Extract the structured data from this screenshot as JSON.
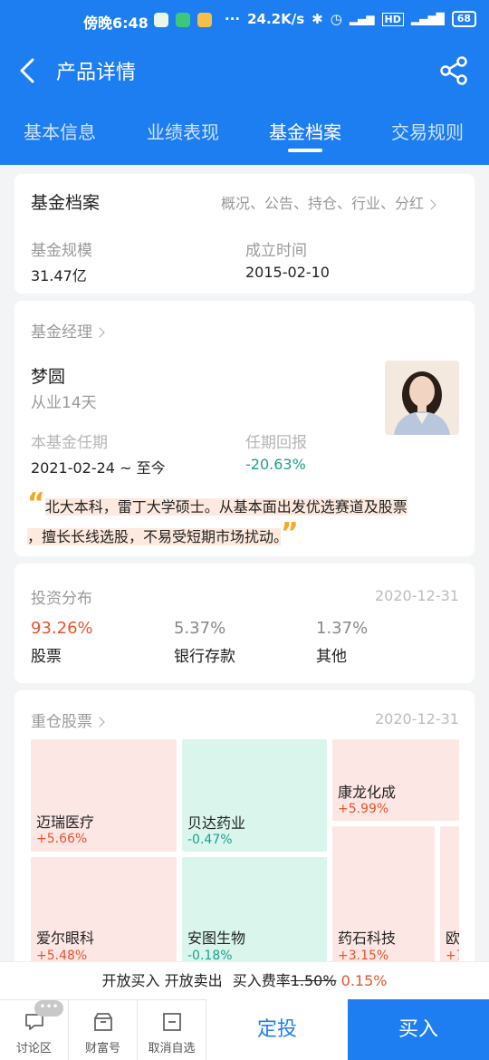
{
  "status_bar": {
    "time": "傍晚6:48",
    "network_speed": "24.2K/s",
    "battery": "68",
    "icons": [
      "wechat-icon",
      "shield-icon",
      "message-icon",
      "more-dots-icon",
      "bluetooth-icon",
      "alarm-icon",
      "signal-3g-icon",
      "hd-icon",
      "signal-4g-icon",
      "battery-icon"
    ]
  },
  "header": {
    "title": "产品详情"
  },
  "tabs": [
    {
      "label": "基本信息",
      "active": false
    },
    {
      "label": "业绩表现",
      "active": false
    },
    {
      "label": "基金档案",
      "active": true
    },
    {
      "label": "交易规则",
      "active": false
    }
  ],
  "archive": {
    "title": "基金档案",
    "links": "概况、公告、持仓、行业、分红",
    "scale_label": "基金规模",
    "scale_value": "31.47亿",
    "found_label": "成立时间",
    "found_value": "2015-02-10"
  },
  "manager": {
    "section_label": "基金经理",
    "name": "梦圆",
    "experience": "从业14天",
    "tenure_label": "本基金任期",
    "tenure_value": "2021-02-24 ~ 至今",
    "return_label": "任期回报",
    "return_value": "-20.63%",
    "quote_line1": "北大本科，雷丁大学硕士。从基本面出发优选赛道及股票",
    "quote_line2": "，擅长长线选股，不易受短期市场扰动。",
    "quote_open": "“",
    "quote_close": "”"
  },
  "allocation": {
    "title": "投资分布",
    "date": "2020-12-31",
    "items": [
      {
        "value": "93.26%",
        "label": "股票"
      },
      {
        "value": "5.37%",
        "label": "银行存款"
      },
      {
        "value": "1.37%",
        "label": "其他"
      }
    ]
  },
  "holdings": {
    "title": "重仓股票",
    "date": "2020-12-31",
    "stocks": [
      {
        "name": "迈瑞医疗",
        "change": "+5.66%"
      },
      {
        "name": "贝达药业",
        "change": "-0.47%"
      },
      {
        "name": "康龙化成",
        "change": "+5.99%"
      },
      {
        "name": "爱尔眼科",
        "change": "+5.48%"
      },
      {
        "name": "安图生物",
        "change": "-0.18%"
      },
      {
        "name": "药石科技",
        "change": "+3.15%"
      },
      {
        "name": "欧",
        "change": "+7"
      }
    ]
  },
  "fee_bar": {
    "open_buy": "开放买入",
    "open_sell": "开放卖出",
    "fee_label": "买入费率",
    "fee_original": "1.50%",
    "fee_discount": "0.15%"
  },
  "bottom_nav": {
    "discuss": "讨论区",
    "fortune": "财富号",
    "unfollow": "取消自选",
    "badge": "•••",
    "dingtou": "定投",
    "buy": "买入"
  },
  "colors": {
    "brand_blue": "#1d7ef2",
    "up_red": "#e8532d",
    "down_green": "#18a38b",
    "accent_orange": "#f5a623"
  }
}
